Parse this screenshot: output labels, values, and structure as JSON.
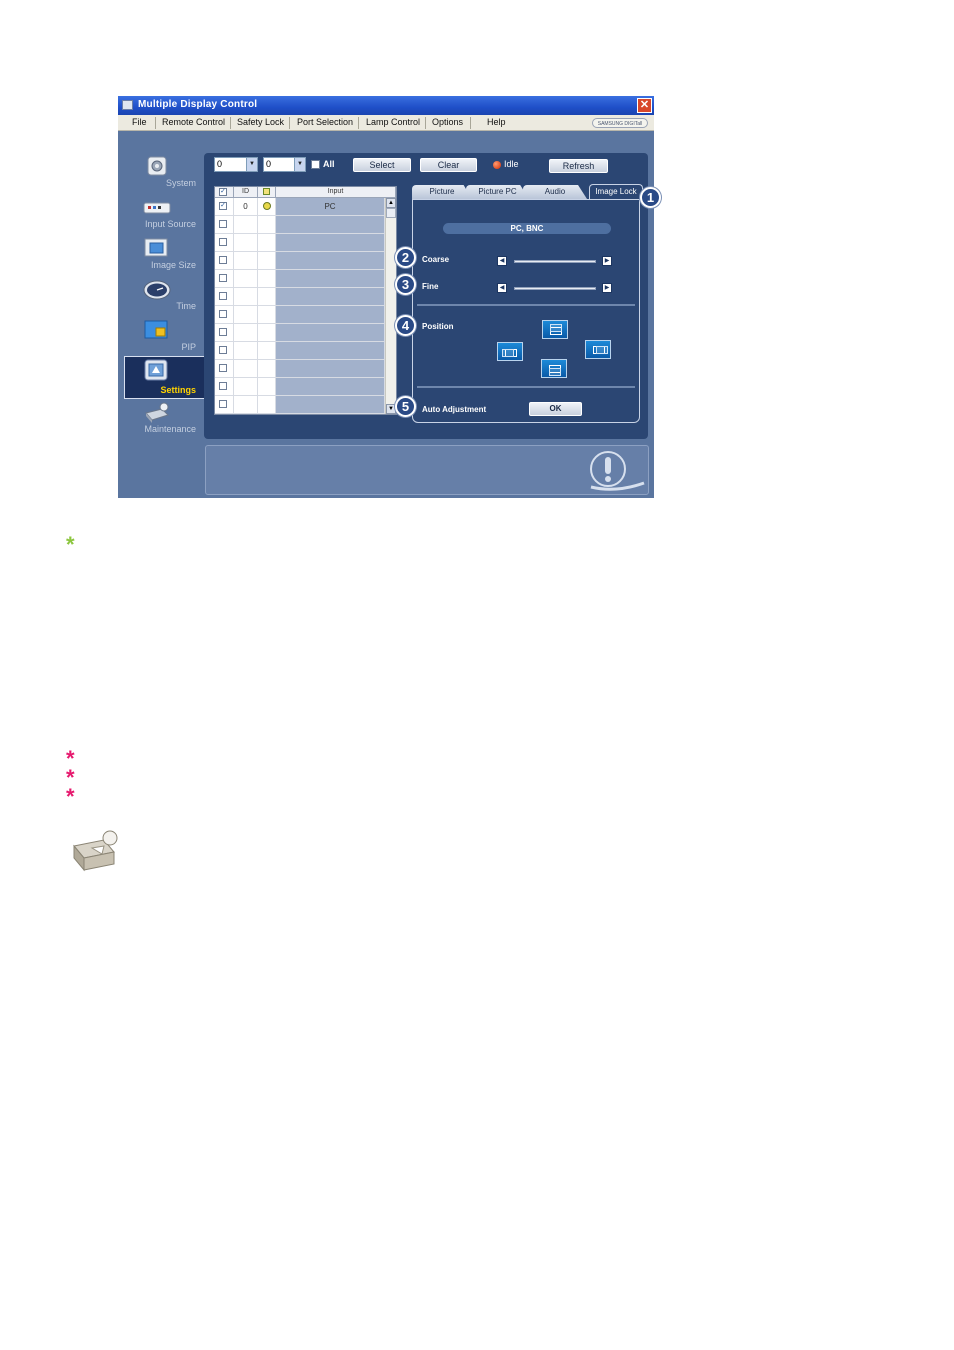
{
  "window": {
    "title": "Multiple Display Control",
    "close_glyph": "✕"
  },
  "menu": [
    "File",
    "Remote Control",
    "Safety Lock",
    "Port Selection",
    "Lamp Control",
    "Options",
    "Help"
  ],
  "brand": "SAMSUNG DIGITall",
  "sidebar": [
    {
      "label": "System",
      "icon": "system-icon",
      "active": false
    },
    {
      "label": "Input Source",
      "icon": "input-source-icon",
      "active": false
    },
    {
      "label": "Image Size",
      "icon": "image-size-icon",
      "active": false
    },
    {
      "label": "Time",
      "icon": "clock-icon",
      "active": false
    },
    {
      "label": "PIP",
      "icon": "pip-icon",
      "active": false
    },
    {
      "label": "Settings",
      "icon": "settings-icon",
      "active": true
    },
    {
      "label": "Maintenance",
      "icon": "maintenance-icon",
      "active": false
    }
  ],
  "toolbar": {
    "combo1_value": "0",
    "combo2_value": "0",
    "all_label": "All",
    "select_label": "Select",
    "clear_label": "Clear",
    "status_label": "Idle",
    "refresh_label": "Refresh"
  },
  "grid": {
    "headers": {
      "id": "ID",
      "input": "Input"
    },
    "rows": [
      {
        "checked": true,
        "id": "0",
        "status": true,
        "input": "PC"
      },
      {
        "checked": false,
        "id": "",
        "status": false,
        "input": ""
      },
      {
        "checked": false,
        "id": "",
        "status": false,
        "input": ""
      },
      {
        "checked": false,
        "id": "",
        "status": false,
        "input": ""
      },
      {
        "checked": false,
        "id": "",
        "status": false,
        "input": ""
      },
      {
        "checked": false,
        "id": "",
        "status": false,
        "input": ""
      },
      {
        "checked": false,
        "id": "",
        "status": false,
        "input": ""
      },
      {
        "checked": false,
        "id": "",
        "status": false,
        "input": ""
      },
      {
        "checked": false,
        "id": "",
        "status": false,
        "input": ""
      },
      {
        "checked": false,
        "id": "",
        "status": false,
        "input": ""
      },
      {
        "checked": false,
        "id": "",
        "status": false,
        "input": ""
      },
      {
        "checked": false,
        "id": "",
        "status": false,
        "input": ""
      }
    ]
  },
  "tabs": [
    {
      "label": "Picture",
      "active": false
    },
    {
      "label": "Picture PC",
      "active": false
    },
    {
      "label": "Audio",
      "active": false
    },
    {
      "label": "Image Lock",
      "active": true
    }
  ],
  "image_lock": {
    "source": "PC, BNC",
    "coarse_label": "Coarse",
    "fine_label": "Fine",
    "position_label": "Position",
    "auto_label": "Auto Adjustment",
    "ok_label": "OK"
  },
  "callouts": [
    "1",
    "2",
    "3",
    "4",
    "5"
  ],
  "colors": {
    "green_star": "#8cc63f",
    "pink_star": "#e6196e",
    "window_blue": "#2b4a8b",
    "selected_yellow": "#ffd200"
  }
}
